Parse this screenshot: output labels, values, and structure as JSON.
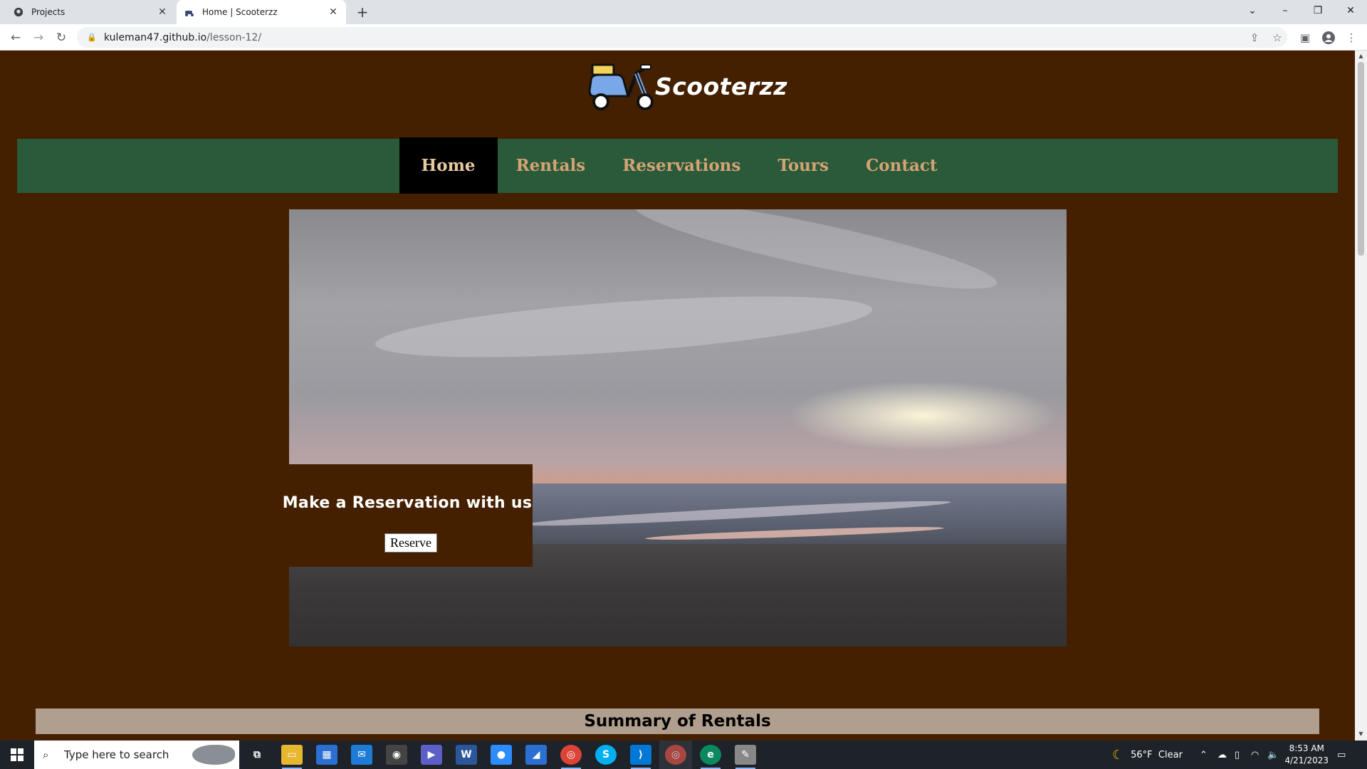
{
  "browser": {
    "tabs": [
      {
        "title": "Projects",
        "active": false
      },
      {
        "title": "Home | Scooterzz",
        "active": true
      }
    ],
    "new_tab_symbol": "+",
    "url": {
      "domain": "kuleman47.github.io",
      "path": "/lesson-12/"
    }
  },
  "site": {
    "brand": "Scooterzz",
    "nav": [
      "Home",
      "Rentals",
      "Reservations",
      "Tours",
      "Contact"
    ],
    "active_nav": "Home",
    "hero": {
      "cta_heading": "Make a Reservation with us",
      "cta_button": "Reserve"
    },
    "summary_heading": "Summary of Rentals"
  },
  "taskbar": {
    "search_placeholder": "Type here to search",
    "weather": "56°F  Clear",
    "time": "8:53 AM",
    "date": "4/21/2023"
  },
  "colors": {
    "page_bg": "#442000",
    "nav_bg": "#2a5a3a",
    "nav_text": "#d4a373",
    "summary_bg": "#b09e8e"
  }
}
